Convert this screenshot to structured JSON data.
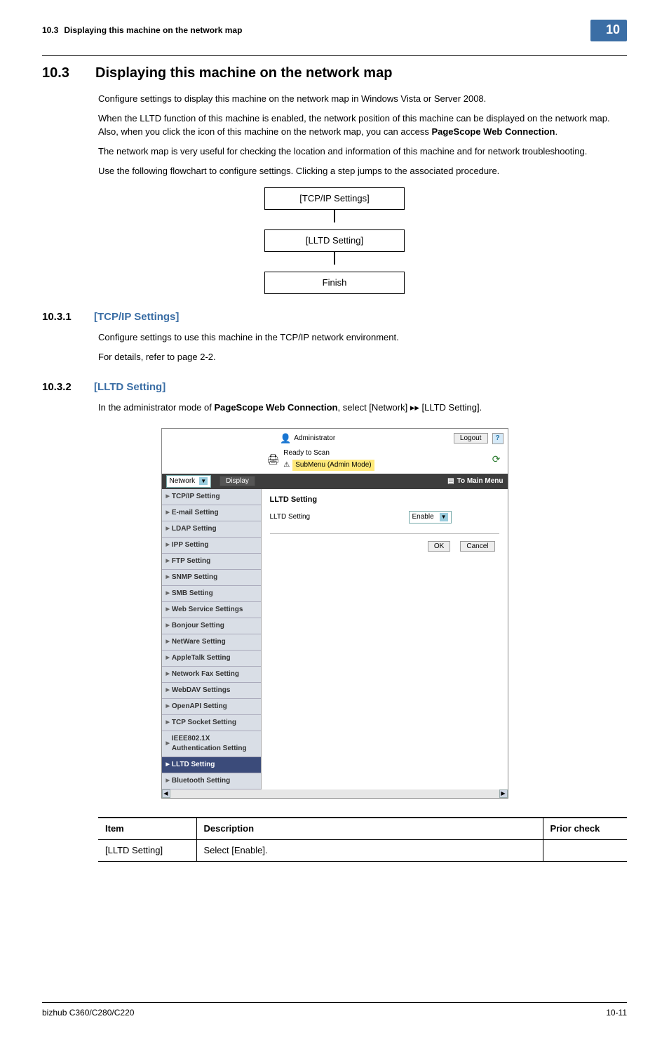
{
  "header": {
    "section_no": "10.3",
    "section_title": "Displaying this machine on the network map",
    "chip": "10"
  },
  "main_title": {
    "num": "10.3",
    "text": "Displaying this machine on the network map"
  },
  "paragraphs": {
    "p1": "Configure settings to display this machine on the network map in Windows Vista or Server 2008.",
    "p2a": "When the LLTD function of this machine is enabled, the network position of this machine can be displayed on the network map. Also, when you click the icon of this machine on the network map, you can access ",
    "p2b": "PageScope Web Connection",
    "p2c": ".",
    "p3": "The network map is very useful for checking the location and information of this machine and for network troubleshooting.",
    "p4": "Use the following flowchart to configure settings. Clicking a step jumps to the associated procedure."
  },
  "flow": {
    "a": "[TCP/IP Settings]",
    "b": "[LLTD Setting]",
    "c": "Finish"
  },
  "sub1": {
    "num": "10.3.1",
    "title": "[TCP/IP Settings]",
    "p1": "Configure settings to use this machine in the TCP/IP network environment.",
    "p2": "For details, refer to page 2-2."
  },
  "sub2": {
    "num": "10.3.2",
    "title": "[LLTD Setting]",
    "p1a": "In the administrator mode of ",
    "p1b": "PageScope Web Connection",
    "p1c": ", select [Network] ",
    "p1d": "▸▸",
    "p1e": " [LLTD Setting]."
  },
  "screenshot": {
    "admin_label": "Administrator",
    "logout": "Logout",
    "ready": "Ready to Scan",
    "submenu": "SubMenu (Admin Mode)",
    "category_label": "Network",
    "display_btn": "Display",
    "to_main_menu": "To Main Menu",
    "sidebar": [
      "TCP/IP Setting",
      "E-mail Setting",
      "LDAP Setting",
      "IPP Setting",
      "FTP Setting",
      "SNMP Setting",
      "SMB Setting",
      "Web Service Settings",
      "Bonjour Setting",
      "NetWare Setting",
      "AppleTalk Setting",
      "Network Fax Setting",
      "WebDAV Settings",
      "OpenAPI Setting",
      "TCP Socket Setting",
      "IEEE802.1X Authentication Setting",
      "LLTD Setting",
      "Bluetooth Setting"
    ],
    "content_title": "LLTD Setting",
    "field_label": "LLTD Setting",
    "field_value": "Enable",
    "ok": "OK",
    "cancel": "Cancel"
  },
  "table": {
    "h1": "Item",
    "h2": "Description",
    "h3": "Prior check",
    "r1c1": "[LLTD Setting]",
    "r1c2": "Select [Enable].",
    "r1c3": ""
  },
  "footer": {
    "left": "bizhub C360/C280/C220",
    "right": "10-11"
  }
}
